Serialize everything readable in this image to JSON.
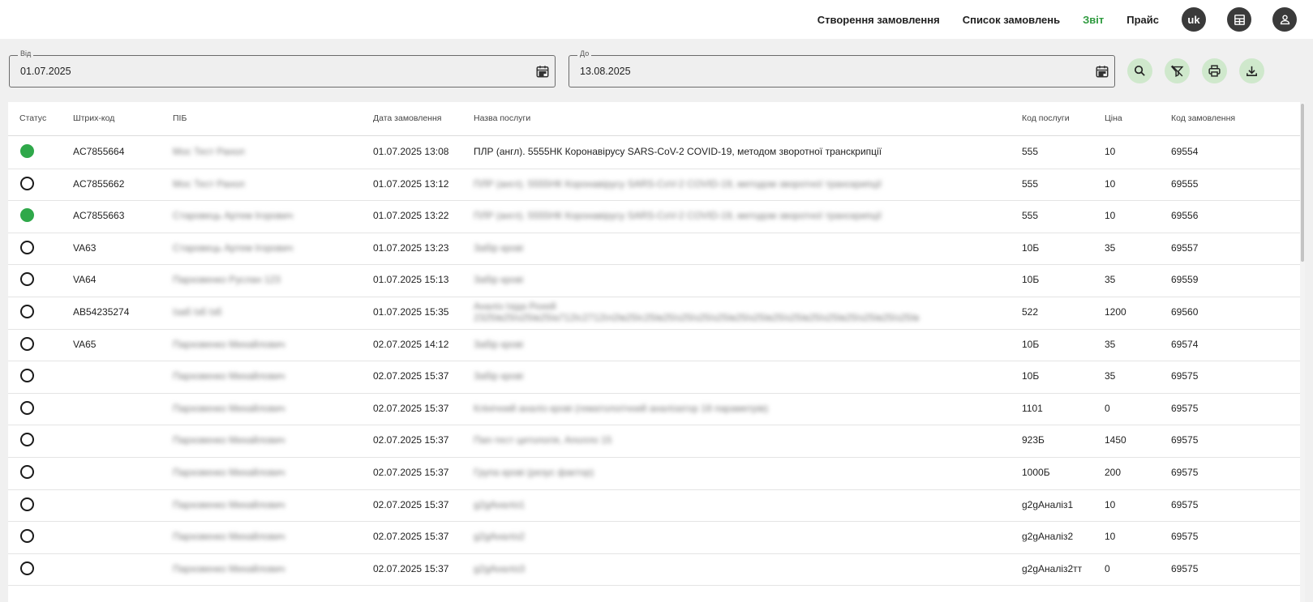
{
  "header": {
    "nav": [
      {
        "label": "Створення замовлення",
        "active": false
      },
      {
        "label": "Список замовлень",
        "active": false
      },
      {
        "label": "Звіт",
        "active": true
      },
      {
        "label": "Прайс",
        "active": false
      }
    ],
    "lang": "uk",
    "icons": [
      "uk-language-button",
      "report-table-icon",
      "user-account-icon"
    ],
    "accent_color": "#2e9a3e"
  },
  "filters": {
    "from": {
      "label": "Від",
      "value": "01.07.2025"
    },
    "to": {
      "label": "До",
      "value": "13.08.2025"
    },
    "actions": [
      "search-icon",
      "clear-filter-icon",
      "print-icon",
      "download-icon"
    ]
  },
  "table": {
    "columns": [
      "Статус",
      "Штрих-код",
      "ПІБ",
      "Дата замовлення",
      "Назва послуги",
      "Код послуги",
      "Ціна",
      "Код замовлення"
    ],
    "rows": [
      {
        "done": true,
        "barcode": "AC7855664",
        "name": "Мос Тест Ранол",
        "date": "01.07.2025 13:08",
        "service": "ПЛР (англ). 5555НК Коронавірусу SARS-CoV-2 COVID-19, методом зворотної транскрипції",
        "service_blurred": false,
        "code": "555",
        "price": "10",
        "order": "69554"
      },
      {
        "done": false,
        "barcode": "AC7855662",
        "name": "Мос Тест Ранол",
        "date": "01.07.2025 13:12",
        "service": "ПЛР (англ). 5555НК Коронавірусу SARS-CoV-2 COVID-19, методом зворотної транскрипції",
        "service_blurred": true,
        "code": "555",
        "price": "10",
        "order": "69555"
      },
      {
        "done": true,
        "barcode": "AC7855663",
        "name": "Старовець Артем Ігорович",
        "date": "01.07.2025 13:22",
        "service": "ПЛР (англ). 5555НК Коронавірусу SARS-CoV-2 COVID-19, методом зворотної транскрипції",
        "service_blurred": true,
        "code": "555",
        "price": "10",
        "order": "69556"
      },
      {
        "done": false,
        "barcode": "VA63",
        "name": "Старовець Артем Ігорович",
        "date": "01.07.2025 13:23",
        "service": "Забір крові",
        "service_blurred": true,
        "code": "10Б",
        "price": "35",
        "order": "69557"
      },
      {
        "done": false,
        "barcode": "VA64",
        "name": "Парховенко Руслан 123",
        "date": "01.07.2025 15:13",
        "service": "Забір крові",
        "service_blurred": true,
        "code": "10Б",
        "price": "35",
        "order": "69559"
      },
      {
        "done": false,
        "barcode": "AB54235274",
        "name": "Ізаб Ізб Ізб",
        "date": "01.07.2025 15:35",
        "service": "Аналіз Ізіда Рохей\n2325Ів25Із25Ів25Іа712Іс2712Іл2Ів25Іс25Ів25Із25Із25Із25Ів25Із25Ів25Із25Ів25Із25Ів25Із25Ів25Із25Ів",
        "service_blurred": true,
        "code": "522",
        "price": "1200",
        "order": "69560"
      },
      {
        "done": false,
        "barcode": "VA65",
        "name": "Парховенко Михайлович",
        "date": "02.07.2025 14:12",
        "service": "Забір крові",
        "service_blurred": true,
        "code": "10Б",
        "price": "35",
        "order": "69574"
      },
      {
        "done": false,
        "barcode": "",
        "name": "Парховенко Михайлович",
        "date": "02.07.2025 15:37",
        "service": "Забір крові",
        "service_blurred": true,
        "code": "10Б",
        "price": "35",
        "order": "69575"
      },
      {
        "done": false,
        "barcode": "",
        "name": "Парховенко Михайлович",
        "date": "02.07.2025 15:37",
        "service": "Клінічний аналіз крові (гематологічний аналізатор 18 параметрів)",
        "service_blurred": true,
        "code": "1101",
        "price": "0",
        "order": "69575"
      },
      {
        "done": false,
        "barcode": "",
        "name": "Парховенко Михайлович",
        "date": "02.07.2025 15:37",
        "service": "Пап-тест цитологія, Аполло 15",
        "service_blurred": true,
        "code": "923Б",
        "price": "1450",
        "order": "69575"
      },
      {
        "done": false,
        "barcode": "",
        "name": "Парховенко Михайлович",
        "date": "02.07.2025 15:37",
        "service": "Група крові (резус фактор)",
        "service_blurred": true,
        "code": "1000Б",
        "price": "200",
        "order": "69575"
      },
      {
        "done": false,
        "barcode": "",
        "name": "Парховенко Михайлович",
        "date": "02.07.2025 15:37",
        "service": "g2gАналіз1",
        "service_blurred": true,
        "code": "g2gАналіз1",
        "price": "10",
        "order": "69575"
      },
      {
        "done": false,
        "barcode": "",
        "name": "Парховенко Михайлович",
        "date": "02.07.2025 15:37",
        "service": "g2gАналіз2",
        "service_blurred": true,
        "code": "g2gАналіз2",
        "price": "10",
        "order": "69575"
      },
      {
        "done": false,
        "barcode": "",
        "name": "Парховенко Михайлович",
        "date": "02.07.2025 15:37",
        "service": "g2gАналіз3",
        "service_blurred": true,
        "code": "g2gАналіз2тт",
        "price": "0",
        "order": "69575"
      }
    ]
  }
}
